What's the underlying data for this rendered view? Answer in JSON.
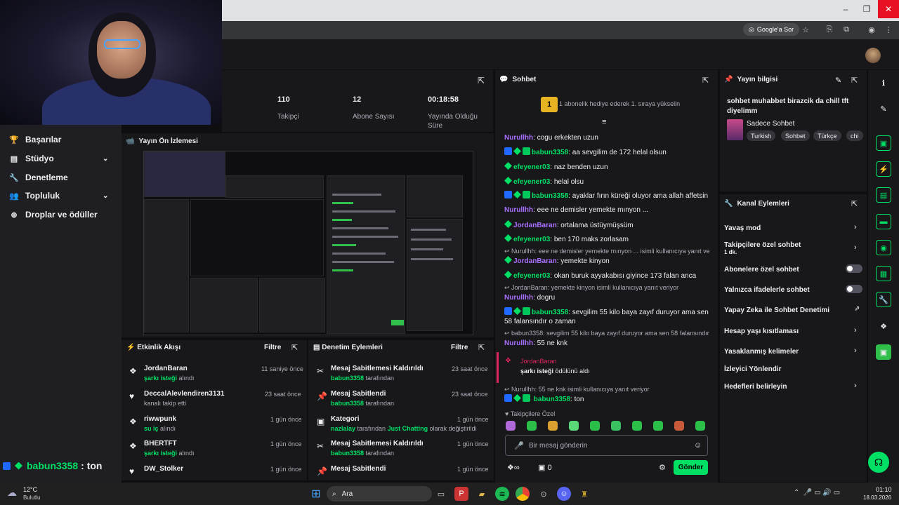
{
  "browser": {
    "search_label": "Google'a Sor"
  },
  "nav": {
    "items": [
      {
        "label": "Başarılar",
        "icon": "trophy-icon"
      },
      {
        "label": "Stüdyo",
        "icon": "studio-icon",
        "chevron": true
      },
      {
        "label": "Denetleme",
        "icon": "wrench-icon"
      },
      {
        "label": "Topluluk",
        "icon": "community-icon",
        "chevron": true
      },
      {
        "label": "Droplar ve ödüller",
        "icon": "drops-icon"
      }
    ]
  },
  "overlay_chat": {
    "user": "babun3358",
    "text": ": ton"
  },
  "stats": [
    {
      "value": "110",
      "label": "Takipçi"
    },
    {
      "value": "12",
      "label": "Abone Sayısı"
    },
    {
      "value": "00:18:58",
      "label": "Yayında Olduğu Süre"
    }
  ],
  "preview": {
    "title": "Yayın Ön İzlemesi"
  },
  "activity": {
    "title": "Etkinlik Akışı",
    "filter": "Filtre",
    "events": [
      {
        "name": "JordanBaran",
        "sub": "şarkı isteği",
        "sub2": " alındı",
        "time": "11 saniye önce",
        "icon": "points-icon"
      },
      {
        "name": "DeccalAlevlendiren3131",
        "sub": "",
        "sub2": "kanalı takip etti",
        "time": "23 saat önce",
        "icon": "heart-icon"
      },
      {
        "name": "riwwpunk",
        "sub": "su iç",
        "sub2": " alındı",
        "time": "1 gün önce",
        "icon": "points-icon"
      },
      {
        "name": "BHERTFT",
        "sub": "şarkı isteği",
        "sub2": " alındı",
        "time": "1 gün önce",
        "icon": "points-icon"
      },
      {
        "name": "DW_Stolker",
        "sub": "",
        "sub2": "",
        "time": "1 gün önce",
        "icon": "heart-icon"
      }
    ]
  },
  "mod": {
    "title": "Denetim Eylemleri",
    "filter": "Filtre",
    "events": [
      {
        "name": "Mesaj Sabitlemesi Kaldırıldı",
        "user": "babun3358",
        "rest": " tarafından",
        "time": "23 saat önce",
        "icon": "unpin-icon"
      },
      {
        "name": "Mesaj Sabitlendi",
        "user": "babun3358",
        "rest": " tarafından",
        "time": "23 saat önce",
        "icon": "pin-icon"
      },
      {
        "name": "Kategori",
        "user": "nazlalay",
        "rest": " tarafından ",
        "cat": "Just Chatting",
        "rest2": " olarak değiştirildi",
        "time": "1 gün önce",
        "icon": "category-icon"
      },
      {
        "name": "Mesaj Sabitlemesi Kaldırıldı",
        "user": "babun3358",
        "rest": " tarafından",
        "time": "1 gün önce",
        "icon": "unpin-icon"
      },
      {
        "name": "Mesaj Sabitlendi",
        "user": "",
        "rest": "",
        "time": "1 gün önce",
        "icon": "pin-icon"
      }
    ]
  },
  "chat": {
    "title": "Sohbet",
    "hype_rank": "1",
    "hype_text": "1 abonelik hediye ederek 1. sıraya yükselin",
    "placeholder": "Bir mesaj gönderin",
    "send": "Gönder",
    "points": "0",
    "subs_only": "Takipçilere Özel",
    "messages": [
      {
        "nick": "Nurullhh",
        "color": "p",
        "badges": [],
        "text": ": cogu erkekten uzun"
      },
      {
        "nick": "babun3358",
        "color": "g",
        "badges": [
          "blue",
          "green",
          "gift"
        ],
        "text": ": aa sevgilim de 172 helal olsun"
      },
      {
        "nick": "efeyener03",
        "color": "g",
        "badges": [
          "green"
        ],
        "text": ": naz benden uzun"
      },
      {
        "nick": "efeyener03",
        "color": "g",
        "badges": [
          "green"
        ],
        "text": ": helal olsu"
      },
      {
        "nick": "babun3358",
        "color": "g",
        "badges": [
          "blue",
          "green",
          "gift"
        ],
        "text": ": ayaklar fırın küreği oluyor ama allah affetsin"
      },
      {
        "nick": "Nurullhh",
        "color": "p",
        "badges": [],
        "text": ": eee ne demisler yemekte mınyon ..."
      },
      {
        "nick": "JordanBaran",
        "color": "p",
        "badges": [
          "green"
        ],
        "text": ": ortalama üstüymüşsüm"
      },
      {
        "nick": "efeyener03",
        "color": "g",
        "badges": [
          "green"
        ],
        "text": ": ben 170 maks zorlasam"
      },
      {
        "reply": "Nurullhh: eee ne demisler yemekte mınyon ... isimli kullanıcıya yanıt ve..."
      },
      {
        "nick": "JordanBaran",
        "color": "p",
        "badges": [
          "green"
        ],
        "text": ": yemekte kinyon"
      },
      {
        "nick": "efeyener03",
        "color": "g",
        "badges": [
          "green"
        ],
        "text": ": okan buruk ayyakabısı giyince 173 falan anca"
      },
      {
        "reply": "JordanBaran: yemekte kinyon isimli kullanıcıya yanıt veriyor"
      },
      {
        "nick": "Nurullhh",
        "color": "p",
        "badges": [],
        "text": ": dogru"
      },
      {
        "nick": "babun3358",
        "color": "g",
        "badges": [
          "blue",
          "green",
          "gift"
        ],
        "text": ": sevgilim 55 kilo baya zayıf duruyor ama sen 58 falansındır o zaman"
      },
      {
        "reply": "babun3358: sevgilim 55 kilo baya zayıf duruyor ama sen 58 falansındır..."
      },
      {
        "nick": "Nurullhh",
        "color": "p",
        "badges": [],
        "text": ": 55 ne knk"
      }
    ],
    "redeem": {
      "user": "JordanBaran",
      "reward": "şarkı isteği",
      "rest": " ödülünü aldı"
    },
    "last_reply": "Nurullhh: 55 ne knk isimli kullanıcıya yanıt veriyor",
    "last": {
      "nick": "babun3358",
      "text": ": ton"
    }
  },
  "info": {
    "title": "Yayın bilgisi",
    "stream_title": "sohbet muhabbet birazcik da chill tft diyelimm",
    "category": "Sadece Sohbet",
    "tags": [
      "Turkish",
      "Sohbet",
      "Türkçe",
      "chi"
    ]
  },
  "actions": {
    "title": "Kanal Eylemleri",
    "items": [
      {
        "label": "Yavaş mod",
        "kind": "chevron"
      },
      {
        "label": "Takipçilere özel sohbet",
        "sub": "1 dk.",
        "kind": "chevron"
      },
      {
        "label": "Abonelere özel sohbet",
        "kind": "toggle"
      },
      {
        "label": "Yalnızca ifadelerle sohbet",
        "kind": "toggle"
      },
      {
        "label": "Yapay Zeka ile Sohbet Denetimi",
        "kind": "external"
      },
      {
        "label": "Hesap yaşı kısıtlaması",
        "kind": "chevron"
      },
      {
        "label": "Yasaklanmış kelimeler",
        "kind": "chevron"
      },
      {
        "label": "İzleyici Yönlendir",
        "kind": "none"
      },
      {
        "label": "Hedefleri belirleyin",
        "kind": "chevron"
      }
    ]
  },
  "taskbar": {
    "weather_temp": "12°C",
    "weather_text": "Bulutlu",
    "search": "Ara",
    "time": "01:10",
    "date": "18.03.2026"
  },
  "colors": {
    "accent": "#00e064",
    "purple": "#a970ff",
    "bg": "#18181b"
  }
}
